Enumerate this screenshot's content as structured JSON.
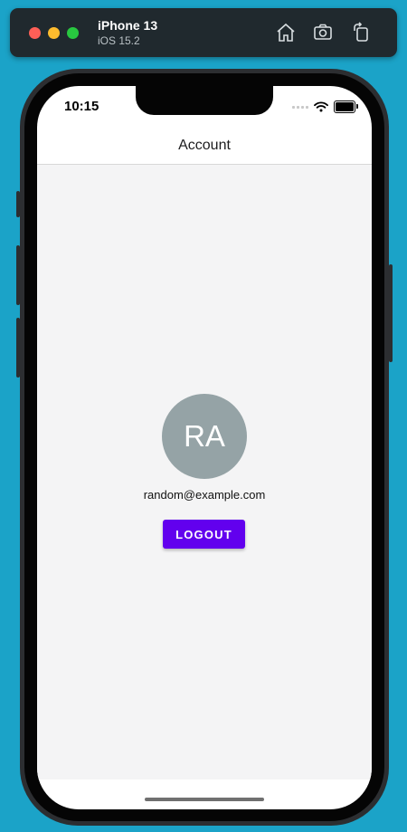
{
  "simulator": {
    "device_name": "iPhone 13",
    "os_version": "iOS 15.2",
    "buttons": {
      "home_icon": "home-icon",
      "screenshot_icon": "camera-icon",
      "rotate_icon": "rotate-icon"
    }
  },
  "status_bar": {
    "time": "10:15"
  },
  "header": {
    "title": "Account"
  },
  "profile": {
    "avatar_initials": "RA",
    "email": "random@example.com",
    "logout_label": "LOGOUT"
  },
  "colors": {
    "background": "#1ba3c8",
    "avatar": "#95a3a6",
    "accent": "#6200ee",
    "content_bg": "#f4f4f5"
  }
}
